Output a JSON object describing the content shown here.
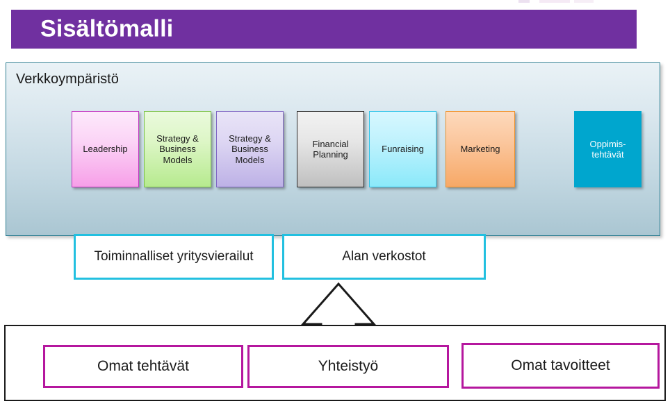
{
  "slide": {
    "title": "Sisältömalli",
    "title_bar_color": "#7030A0"
  },
  "environment_panel": {
    "label": "Verkkoympäristö",
    "border_color": "#2f7f92",
    "modules": [
      {
        "id": "leadership",
        "label": "Leadership",
        "accent": "#c033c0"
      },
      {
        "id": "strategy-1",
        "label": "Strategy & Business Models",
        "accent": "#7cc24a"
      },
      {
        "id": "strategy-2",
        "label": "Strategy & Business Models",
        "accent": "#8168c4"
      },
      {
        "id": "financial",
        "label": "Financial Planning",
        "accent": "#2b2b2b"
      },
      {
        "id": "funraising",
        "label": "Funraising",
        "accent": "#2ec3e8"
      },
      {
        "id": "marketing",
        "label": "Marketing",
        "accent": "#f0922a"
      },
      {
        "id": "oppimistehtavat",
        "label": "Oppimis-tehtävät",
        "accent": "#00a6ce"
      }
    ]
  },
  "connectors": {
    "border_color": "#22c0e0",
    "items": [
      {
        "id": "company-visits",
        "label": "Toiminnalliset yritysvierailut"
      },
      {
        "id": "networks",
        "label": "Alan verkostot"
      }
    ],
    "arrow": "up-arrow"
  },
  "bottom_panel": {
    "border_color": "#1a1a1a",
    "box_border_color": "#b5179e",
    "items": [
      {
        "id": "own-tasks",
        "label": "Omat tehtävät"
      },
      {
        "id": "cooperation",
        "label": "Yhteistyö"
      },
      {
        "id": "own-goals",
        "label": "Omat tavoitteet"
      }
    ]
  }
}
